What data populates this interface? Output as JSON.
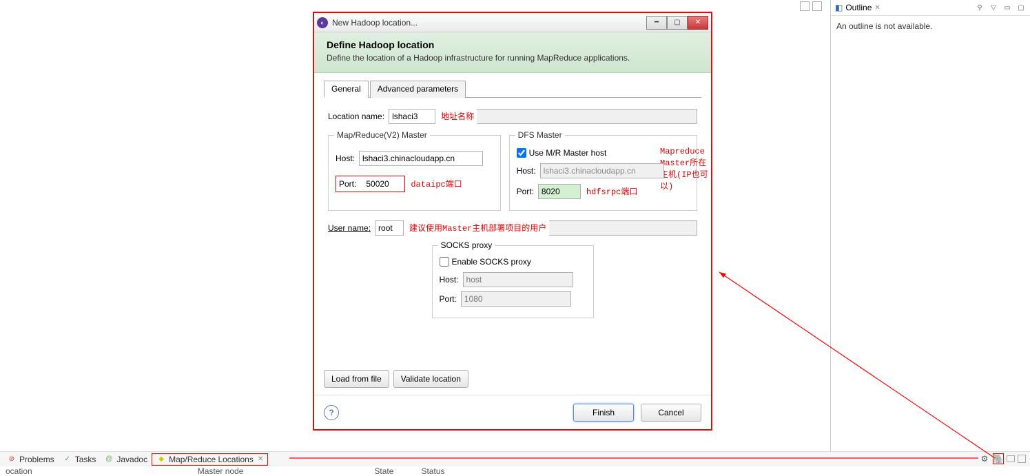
{
  "outline": {
    "title": "Outline",
    "message": "An outline is not available."
  },
  "dialog": {
    "window_title": "New Hadoop location...",
    "header_title": "Define Hadoop location",
    "header_desc": "Define the location of a Hadoop infrastructure for running MapReduce applications.",
    "tabs": {
      "general": "General",
      "advanced": "Advanced parameters"
    },
    "location_name_label": "Location name:",
    "location_name": "lshaci3",
    "mr_master": {
      "legend": "Map/Reduce(V2) Master",
      "host_label": "Host:",
      "host": "lshaci3.chinacloudapp.cn",
      "port_label": "Port:",
      "port": "50020"
    },
    "dfs_master": {
      "legend": "DFS Master",
      "use_mr_label": "Use M/R Master host",
      "host_label": "Host:",
      "host": "lshaci3.chinacloudapp.cn",
      "port_label": "Port:",
      "port": "8020"
    },
    "user_name_label": "User name:",
    "user_name": "root",
    "socks": {
      "legend": "SOCKS proxy",
      "enable_label": "Enable SOCKS proxy",
      "host_label": "Host:",
      "host_placeholder": "host",
      "port_label": "Port:",
      "port_placeholder": "1080"
    },
    "buttons": {
      "load": "Load from file",
      "validate": "Validate location",
      "finish": "Finish",
      "cancel": "Cancel"
    }
  },
  "annotations": {
    "addr_name": "地址名称",
    "mr_host": "Mapreduce Master所在主机(IP也可以)",
    "data_ipc": "dataipc端口",
    "hdfs_rpc": "hdfsrpc端口",
    "user_hint": "建议使用Master主机部署项目的用户"
  },
  "bottom_views": {
    "problems": "Problems",
    "tasks": "Tasks",
    "javadoc": "Javadoc",
    "mapreduce": "Map/Reduce Locations"
  },
  "col_headers": {
    "location": "ocation",
    "master_node": "Master node",
    "state": "State",
    "status": "Status"
  }
}
